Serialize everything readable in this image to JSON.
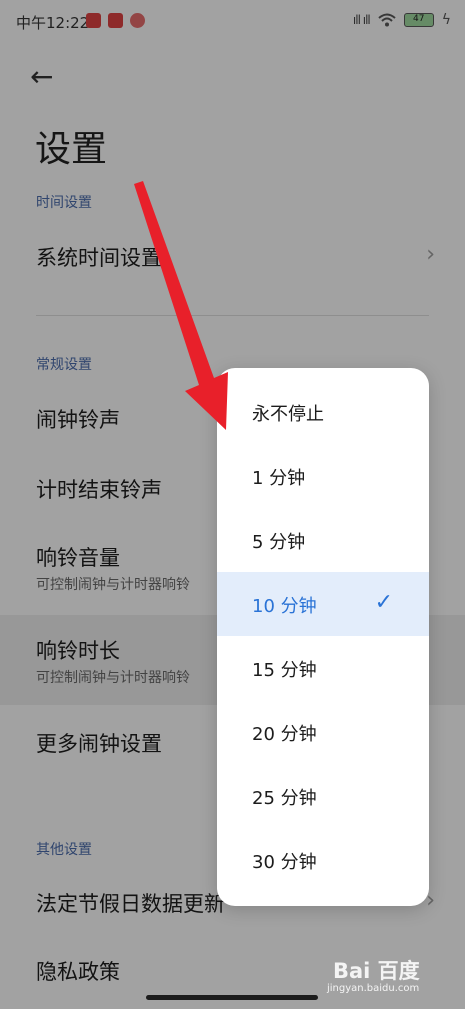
{
  "status_bar": {
    "time": "中午12:22",
    "signal": "ıll ıll",
    "wifi_icon": "wifi-icon",
    "battery": "47"
  },
  "header": {
    "back_icon": "back-arrow-icon",
    "back_glyph": "←",
    "title": "设置"
  },
  "sections": {
    "time": "时间设置",
    "general": "常规设置",
    "other": "其他设置"
  },
  "rows": {
    "system_time": "系统时间设置",
    "alarm_ringtone": "闹钟铃声",
    "timer_ringtone": "计时结束铃声",
    "ring_volume": "响铃音量",
    "ring_volume_sub": "可控制闹钟与计时器响铃",
    "ring_duration": "响铃时长",
    "ring_duration_sub": "可控制闹钟与计时器响铃",
    "more_alarm": "更多闹钟设置",
    "holiday_update": "法定节假日数据更新",
    "privacy": "隐私政策"
  },
  "dropdown": {
    "selected_index": 3,
    "options": [
      "永不停止",
      "1 分钟",
      "5 分钟",
      "10 分钟",
      "15 分钟",
      "20 分钟",
      "25 分钟",
      "30 分钟"
    ],
    "check_glyph": "✓"
  },
  "watermark": {
    "logo": "Bai 百度",
    "url": "jingyan.baidu.com"
  },
  "colors": {
    "accent": "#2a73d6",
    "selected_bg": "#e3edfb",
    "arrow": "#e8202a",
    "section_header": "#4a6aa8"
  }
}
